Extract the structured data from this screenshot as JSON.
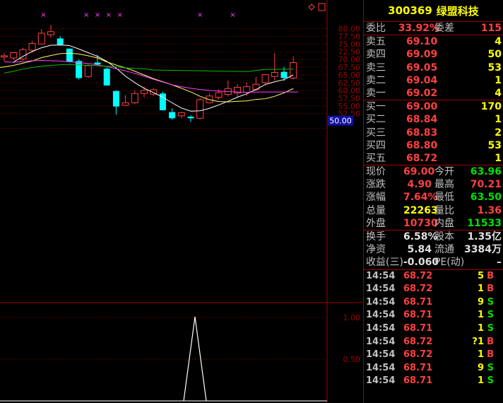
{
  "chart_data": {
    "type": "candlestick",
    "y_ticks": [
      "80.00",
      "77.50",
      "75.00",
      "72.50",
      "70.00",
      "67.50",
      "65.00",
      "62.50",
      "60.00",
      "57.50",
      "55.00",
      "52.50",
      "50.00"
    ],
    "ylim": [
      49.5,
      82.0
    ],
    "current_price_tag": "50.00",
    "volume_ticks": [
      "1.00",
      "0.50"
    ],
    "candles": [
      {
        "o": 70.8,
        "h": 72.0,
        "l": 69.5,
        "c": 71.2
      },
      {
        "o": 70.5,
        "h": 72.4,
        "l": 69.8,
        "c": 72.2
      },
      {
        "o": 70.2,
        "h": 73.8,
        "l": 69.6,
        "c": 73.2
      },
      {
        "o": 73.0,
        "h": 76.0,
        "l": 72.2,
        "c": 75.2
      },
      {
        "o": 75.0,
        "h": 79.8,
        "l": 74.8,
        "c": 78.5
      },
      {
        "o": 78.0,
        "h": 81.2,
        "l": 77.0,
        "c": 79.0
      },
      {
        "o": 76.8,
        "h": 77.6,
        "l": 74.5,
        "c": 74.8
      },
      {
        "o": 73.5,
        "h": 73.6,
        "l": 69.0,
        "c": 69.2
      },
      {
        "o": 69.5,
        "h": 70.0,
        "l": 63.5,
        "c": 64.0
      },
      {
        "o": 64.5,
        "h": 68.5,
        "l": 64.0,
        "c": 68.0
      },
      {
        "o": 69.0,
        "h": 71.5,
        "l": 68.0,
        "c": 68.4
      },
      {
        "o": 67.0,
        "h": 67.4,
        "l": 61.5,
        "c": 61.6
      },
      {
        "o": 59.8,
        "h": 60.0,
        "l": 52.2,
        "c": 54.8
      },
      {
        "o": 55.2,
        "h": 58.5,
        "l": 55.0,
        "c": 56.0
      },
      {
        "o": 56.0,
        "h": 60.0,
        "l": 55.5,
        "c": 59.0
      },
      {
        "o": 59.0,
        "h": 61.2,
        "l": 57.8,
        "c": 60.0
      },
      {
        "o": 58.8,
        "h": 60.8,
        "l": 58.2,
        "c": 60.2
      },
      {
        "o": 59.0,
        "h": 59.6,
        "l": 53.5,
        "c": 53.6
      },
      {
        "o": 53.0,
        "h": 54.2,
        "l": 50.5,
        "c": 51.0
      },
      {
        "o": 51.8,
        "h": 53.2,
        "l": 51.0,
        "c": 52.8
      },
      {
        "o": 51.5,
        "h": 52.0,
        "l": 49.8,
        "c": 51.0
      },
      {
        "o": 51.0,
        "h": 57.5,
        "l": 50.6,
        "c": 57.0
      },
      {
        "o": 56.0,
        "h": 59.0,
        "l": 55.8,
        "c": 58.2
      },
      {
        "o": 57.8,
        "h": 60.3,
        "l": 57.0,
        "c": 59.3
      },
      {
        "o": 58.7,
        "h": 63.2,
        "l": 58.0,
        "c": 60.6
      },
      {
        "o": 59.2,
        "h": 62.0,
        "l": 58.0,
        "c": 61.0
      },
      {
        "o": 59.4,
        "h": 62.6,
        "l": 58.2,
        "c": 61.2
      },
      {
        "o": 60.3,
        "h": 64.4,
        "l": 59.8,
        "c": 62.0
      },
      {
        "o": 62.5,
        "h": 65.2,
        "l": 61.8,
        "c": 65.1
      },
      {
        "o": 64.5,
        "h": 72.0,
        "l": 63.2,
        "c": 65.8
      },
      {
        "o": 66.0,
        "h": 67.6,
        "l": 63.0,
        "c": 64.0
      },
      {
        "o": 64.0,
        "h": 71.0,
        "l": 63.5,
        "c": 69.0
      }
    ],
    "ma_white": [
      69.2,
      71.0,
      72.6,
      73.8,
      74.6,
      74.7,
      74.5,
      73.4,
      72.2,
      71.0,
      69.4,
      67.2,
      64.6,
      62.5,
      60.7,
      59.3,
      57.8,
      56.0,
      54.3,
      53.3,
      53.4,
      54.2,
      55.3,
      56.5,
      57.8,
      58.9,
      60.3,
      61.9,
      62.8,
      63.5,
      65.0
    ],
    "ma_yellow": [
      66.8,
      67.2,
      67.6,
      68.1,
      68.8,
      69.5,
      70.6,
      71.3,
      71.9,
      72.0,
      71.8,
      71.2,
      70.5,
      69.2,
      68.2,
      67.3,
      66.2,
      65.0,
      63.8,
      62.8,
      61.8,
      60.7,
      59.5,
      58.1,
      57.0,
      56.4,
      56.3,
      56.5,
      56.6,
      57.1,
      57.3,
      58.1,
      59.2,
      60.6
    ],
    "ma_magenta": [
      69.3,
      69.1,
      69.3,
      69.6,
      69.7,
      69.6,
      69.5,
      69.3,
      69.0,
      68.7,
      68.3,
      67.7,
      67.0,
      66.3,
      65.5,
      64.6,
      63.6,
      62.7,
      61.8,
      61.2,
      60.7,
      60.3,
      60.0,
      59.8,
      59.6,
      59.5,
      59.4,
      59.5
    ],
    "ma_green": [
      65.6,
      66.2,
      66.9,
      67.4,
      67.8,
      68.1,
      68.3,
      68.4,
      68.3,
      68.1,
      68.0,
      67.8,
      67.6,
      67.3,
      67.1,
      67.0,
      66.6
    ],
    "volume_spike_at_candle": 20
  },
  "stock": {
    "code": "300369",
    "name": "绿盟科技"
  },
  "weibi": {
    "label": "委比",
    "value": "33.92%",
    "label2": "委差",
    "value2": "115"
  },
  "asks": [
    {
      "label": "卖五",
      "price": "69.10",
      "vol": "4"
    },
    {
      "label": "卖四",
      "price": "69.09",
      "vol": "50"
    },
    {
      "label": "卖三",
      "price": "69.05",
      "vol": "53"
    },
    {
      "label": "卖二",
      "price": "69.04",
      "vol": "1"
    },
    {
      "label": "卖一",
      "price": "69.02",
      "vol": "4"
    }
  ],
  "bids": [
    {
      "label": "买一",
      "price": "69.00",
      "vol": "170"
    },
    {
      "label": "买二",
      "price": "68.84",
      "vol": "1"
    },
    {
      "label": "买三",
      "price": "68.83",
      "vol": "2"
    },
    {
      "label": "买四",
      "price": "68.80",
      "vol": "53"
    },
    {
      "label": "买五",
      "price": "68.72",
      "vol": "1"
    }
  ],
  "quote": [
    {
      "l1": "现价",
      "v1": "69.00",
      "c1": "red",
      "l2": "今开",
      "v2": "63.96",
      "c2": "green"
    },
    {
      "l1": "涨跌",
      "v1": "4.90",
      "c1": "red",
      "l2": "最高",
      "v2": "70.21",
      "c2": "red"
    },
    {
      "l1": "涨幅",
      "v1": "7.64%",
      "c1": "red",
      "l2": "最低",
      "v2": "63.50",
      "c2": "green"
    },
    {
      "l1": "总量",
      "v1": "22263",
      "c1": "yellow",
      "l2": "量比",
      "v2": "1.36",
      "c2": "red"
    },
    {
      "l1": "外盘",
      "v1": "10730",
      "c1": "red",
      "l2": "内盘",
      "v2": "11533",
      "c2": "green"
    }
  ],
  "fund": [
    {
      "l1": "换手",
      "v1": "6.58%",
      "c1": "white",
      "l2": "股本",
      "v2": "1.35亿",
      "c2": "white"
    },
    {
      "l1": "净资",
      "v1": "5.84",
      "c1": "white",
      "l2": "流通",
      "v2": "3384万",
      "c2": "white"
    },
    {
      "l1": "收益(三)",
      "v1": "-0.060",
      "c1": "white",
      "l2": "PE(动)",
      "v2": "–",
      "c2": "white"
    }
  ],
  "ticks": [
    {
      "t": "14:54",
      "p": "68.72",
      "v": "5",
      "d": "B"
    },
    {
      "t": "14:54",
      "p": "68.72",
      "v": "1",
      "d": "B"
    },
    {
      "t": "14:54",
      "p": "68.71",
      "v": "9",
      "d": "S"
    },
    {
      "t": "14:54",
      "p": "68.71",
      "v": "1",
      "d": "S"
    },
    {
      "t": "14:54",
      "p": "68.71",
      "v": "1",
      "d": "S"
    },
    {
      "t": "14:54",
      "p": "68.72",
      "v": "?1",
      "d": "B"
    },
    {
      "t": "14:54",
      "p": "68.72",
      "v": "1",
      "d": "B"
    },
    {
      "t": "14:54",
      "p": "68.71",
      "v": "9",
      "d": "S"
    },
    {
      "t": "14:54",
      "p": "68.71",
      "v": "1",
      "d": "S"
    }
  ],
  "colors": {
    "up": "#ff4040",
    "down": "#00ffff",
    "grid": "#a00000",
    "ma1": "#ffffff",
    "ma2": "#ffff60",
    "ma3": "#ff40ff",
    "ma4": "#00c000"
  }
}
